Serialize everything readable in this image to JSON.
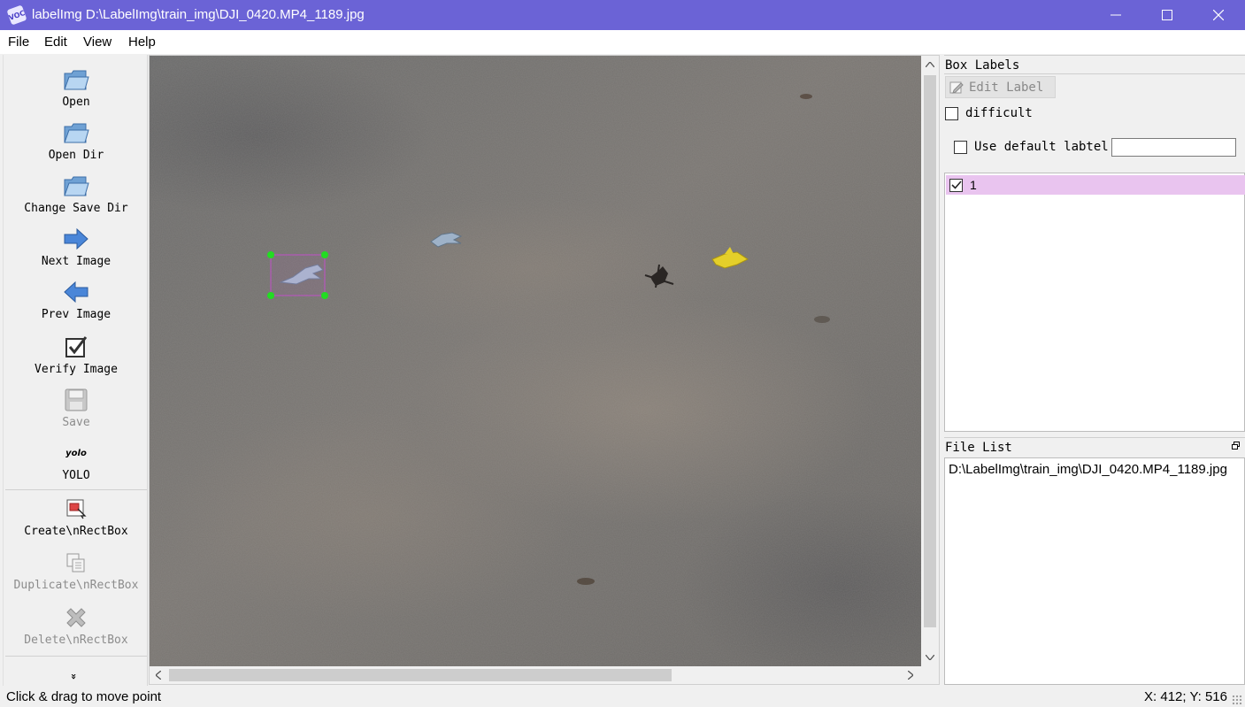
{
  "window": {
    "title": "labelImg D:\\LabelImg\\train_img\\DJI_0420.MP4_1189.jpg",
    "app_icon_text": "VOC",
    "controls": [
      "minimize",
      "maximize",
      "close"
    ]
  },
  "menu": {
    "items": [
      "File",
      "Edit",
      "View",
      "Help"
    ]
  },
  "toolbar": {
    "items": [
      {
        "label": "Open",
        "icon": "folder-open-icon",
        "enabled": true
      },
      {
        "label": "Open Dir",
        "icon": "folder-open-icon",
        "enabled": true
      },
      {
        "label": "Change Save Dir",
        "icon": "folder-open-icon",
        "enabled": true
      },
      {
        "label": "Next Image",
        "icon": "arrow-right-icon",
        "enabled": true
      },
      {
        "label": "Prev Image",
        "icon": "arrow-left-icon",
        "enabled": true
      },
      {
        "label": "Verify Image",
        "icon": "checkbox-icon",
        "enabled": true
      },
      {
        "label": "Save",
        "icon": "floppy-disk-icon",
        "enabled": false
      },
      {
        "label": "YOLO",
        "icon": "yolo-icon",
        "icon_text": "yolo",
        "enabled": true
      },
      {
        "label": "Create\\nRectBox",
        "icon": "create-box-icon",
        "enabled": true
      },
      {
        "label": "Duplicate\\nRectBox",
        "icon": "duplicate-icon",
        "enabled": false
      },
      {
        "label": "Delete\\nRectBox",
        "icon": "delete-icon",
        "enabled": false
      }
    ],
    "more_icon": "»"
  },
  "canvas": {
    "image": "DJI_0420.MP4_1189.jpg",
    "annotation": {
      "label": "1",
      "color": "#c050c8",
      "selected": true
    }
  },
  "box_labels": {
    "title": "Box Labels",
    "edit_label_button": "Edit Label",
    "difficult_label": "difficult",
    "difficult_checked": false,
    "use_default_label": "Use default labtel",
    "use_default_checked": false,
    "default_label_value": "",
    "labels": [
      {
        "text": "1",
        "checked": true,
        "color": "#e9c4ef"
      }
    ]
  },
  "file_list": {
    "title": "File List",
    "files": [
      "D:\\LabelImg\\train_img\\DJI_0420.MP4_1189.jpg"
    ]
  },
  "status": {
    "message": "Click & drag to move point",
    "coords": "X: 412; Y: 516"
  }
}
